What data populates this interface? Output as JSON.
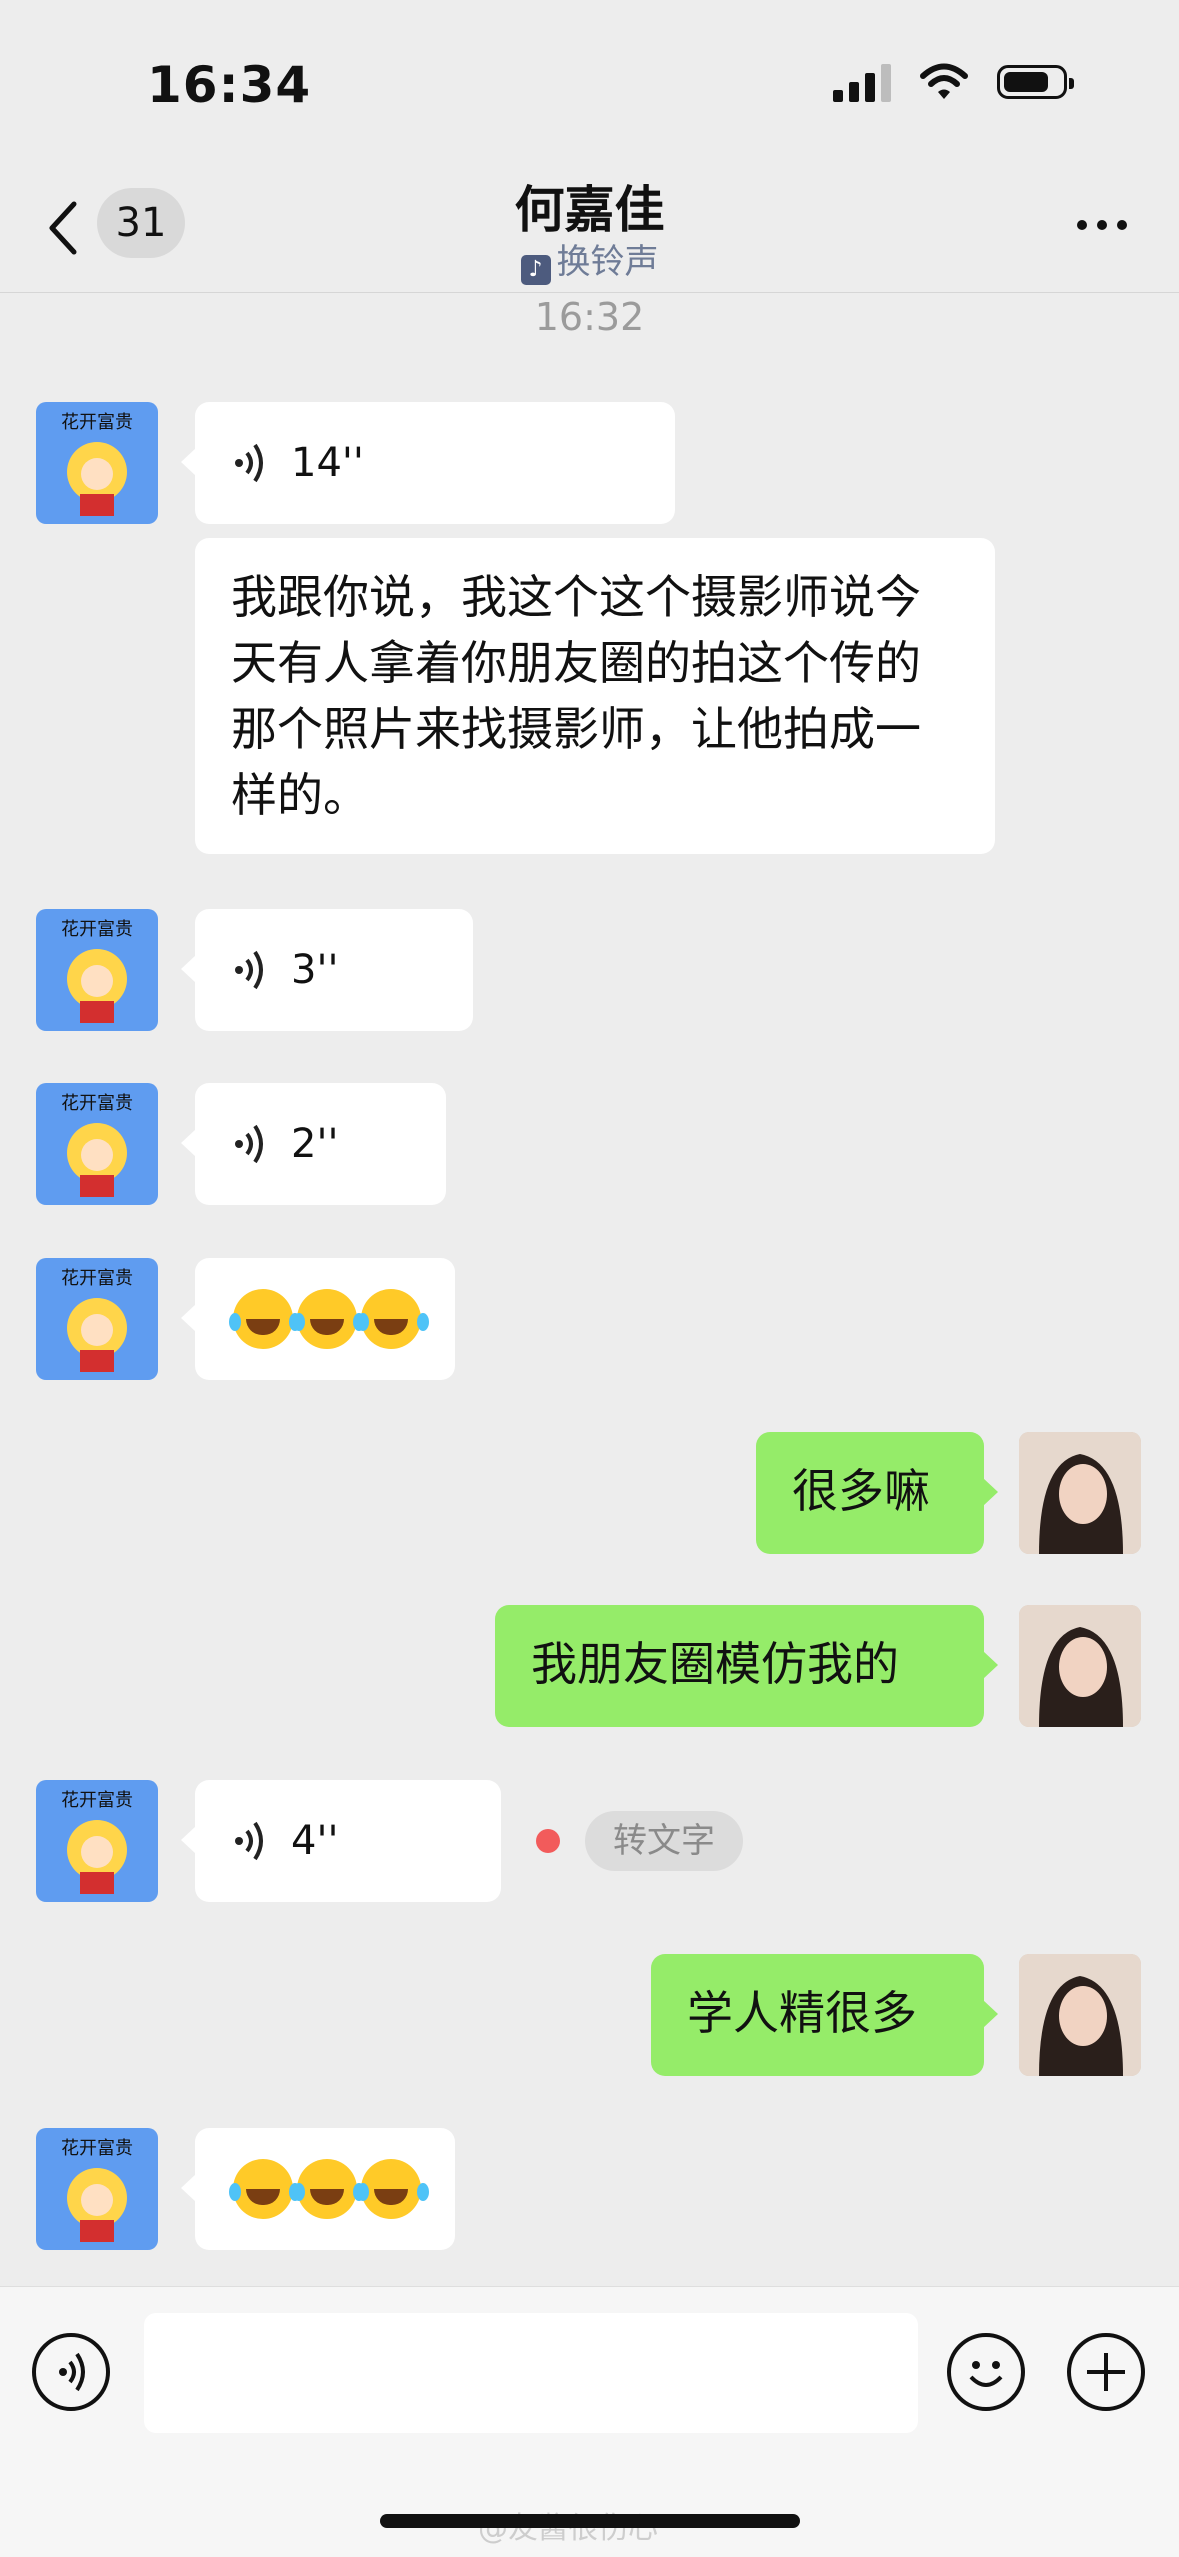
{
  "status_bar": {
    "time": "16:34",
    "battery_level": 0.8
  },
  "nav": {
    "unread_count": "31",
    "title": "何嘉佳",
    "subtitle_icon": "music-note-icon",
    "subtitle": "换铃声"
  },
  "time_separator": "16:32",
  "messages": [
    {
      "side": "left",
      "type": "voice",
      "duration": "14''"
    },
    {
      "side": "left",
      "type": "text",
      "text": "我跟你说，我这个这个摄影师说今天有人拿着你朋友圈的拍这个传的那个照片来找摄影师，让他拍成一样的。"
    },
    {
      "side": "left",
      "type": "voice",
      "duration": "3''"
    },
    {
      "side": "left",
      "type": "voice",
      "duration": "2''"
    },
    {
      "side": "left",
      "type": "emoji",
      "emoji": "laugh-cry x3"
    },
    {
      "side": "right",
      "type": "text",
      "text": "很多嘛"
    },
    {
      "side": "right",
      "type": "text",
      "text": "我朋友圈模仿我的"
    },
    {
      "side": "left",
      "type": "voice",
      "duration": "4''",
      "action": "转文字"
    },
    {
      "side": "right",
      "type": "text",
      "text": "学人精很多"
    },
    {
      "side": "left",
      "type": "emoji",
      "emoji": "laugh-cry x3"
    }
  ],
  "input_bar": {
    "voice_icon": "voice-input-icon",
    "emoji_icon": "smile-icon",
    "plus_icon": "plus-icon"
  },
  "watermark": "@友酱很伤心",
  "colors": {
    "background": "#ededed",
    "my_bubble": "#95ec69",
    "other_bubble": "#ffffff",
    "accent_subtitle": "#6f7c97"
  }
}
